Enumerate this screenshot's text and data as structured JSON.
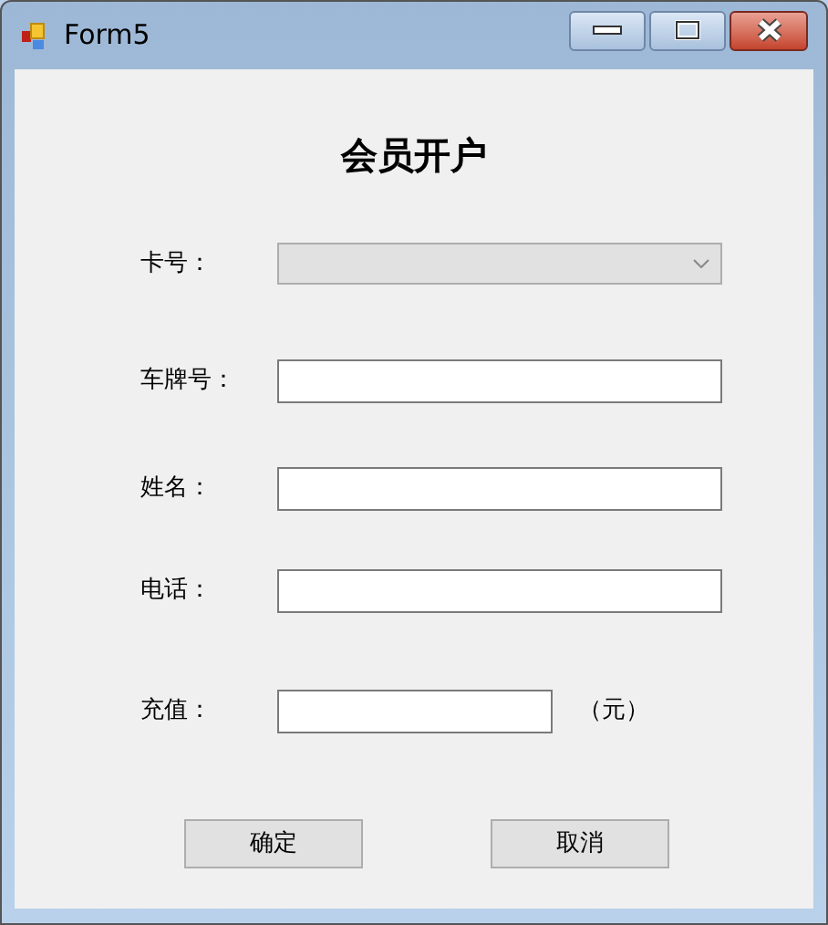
{
  "window": {
    "title": "Form5"
  },
  "heading": "会员开户",
  "fields": [
    {
      "kind": "combo",
      "label": "卡号：",
      "disabled": true
    },
    {
      "kind": "text",
      "label": "车牌号："
    },
    {
      "kind": "text",
      "label": "姓名："
    },
    {
      "kind": "text",
      "label": "电话："
    },
    {
      "kind": "short",
      "label": "充值：",
      "unit": "（元）"
    }
  ],
  "buttons": [
    "确定",
    "取消"
  ]
}
